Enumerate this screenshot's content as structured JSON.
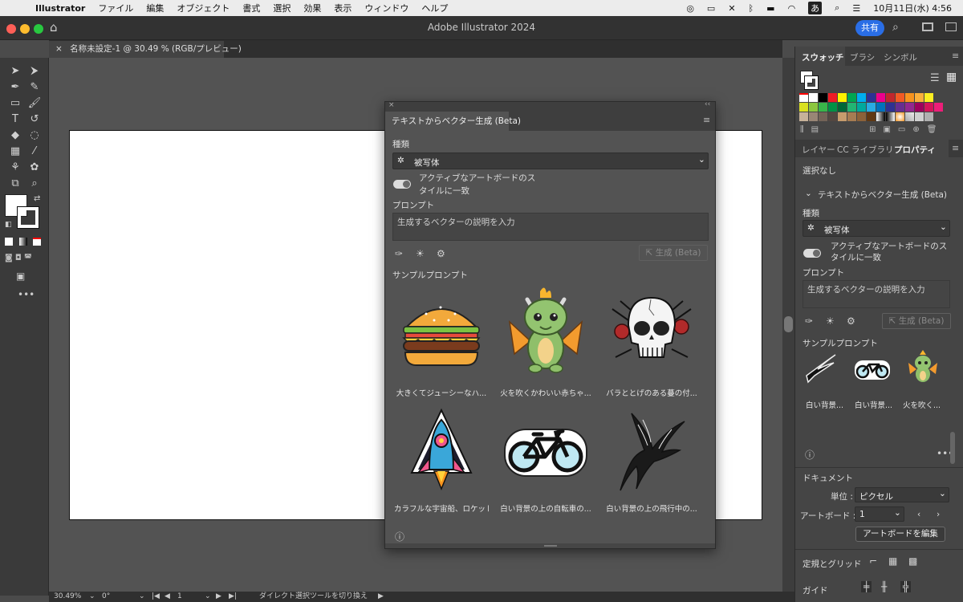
{
  "menubar": {
    "app": "Illustrator",
    "items": [
      "ファイル",
      "編集",
      "オブジェクト",
      "書式",
      "選択",
      "効果",
      "表示",
      "ウィンドウ",
      "ヘルプ"
    ],
    "ime": "あ",
    "clock": "10月11日(水)  4:56"
  },
  "window": {
    "title": "Adobe Illustrator 2024",
    "share_label": "共有",
    "doc_tab": "名称未設定-1 @ 30.49 % (RGB/プレビュー)"
  },
  "right_panel": {
    "tabs_top": [
      "スウォッチ",
      "ブラシ",
      "シンボル"
    ],
    "tabs_mid": [
      "レイヤー",
      "CC ライブラリ",
      "プロパティ"
    ],
    "no_selection": "選択なし",
    "section_title": "テキストからベクター生成 (Beta)",
    "kind_label": "種類",
    "kind_value": "被写体",
    "match_style": "アクティブなアートボードのスタイルに一致",
    "prompt_label": "プロンプト",
    "prompt_placeholder": "生成するベクターの説明を入力",
    "generate_label": "生成 (Beta)",
    "samples_label": "サンプルプロンプト",
    "sample_captions": [
      "白い背景...",
      "白い背景...",
      "火を吹く..."
    ],
    "document_label": "ドキュメント",
    "unit_label": "単位 :",
    "unit_value": "ピクセル",
    "artboard_label": "アートボード :",
    "artboard_value": "1",
    "edit_artboard": "アートボードを編集",
    "rulers_label": "定規とグリッド",
    "guides_label": "ガイド"
  },
  "dialog": {
    "tab": "テキストからベクター生成 (Beta)",
    "kind_label": "種類",
    "kind_value": "被写体",
    "match_style_line1": "アクティブなアートボードのス",
    "match_style_line2": "タイルに一致",
    "prompt_label": "プロンプト",
    "prompt_placeholder": "生成するベクターの説明を入力",
    "generate_label": "生成 (Beta)",
    "samples_label": "サンプルプロンプト",
    "samples": [
      {
        "caption": "大きくてジューシーなハ...",
        "icon": "hamburger-icon"
      },
      {
        "caption": "火を吹くかわいい赤ちゃ...",
        "icon": "dragon-icon"
      },
      {
        "caption": "バラととげのある蔓の付...",
        "icon": "skull-icon"
      },
      {
        "caption": "カラフルな宇宙船、ロケット",
        "icon": "rocket-icon"
      },
      {
        "caption": "白い背景の上の自転車の...",
        "icon": "bicycle-icon"
      },
      {
        "caption": "白い背景の上の飛行中の...",
        "icon": "bird-icon"
      }
    ]
  },
  "status": {
    "zoom": "30.49%",
    "rotation": "0°",
    "artboard_num": "1",
    "tool_hint": "ダイレクト選択ツールを切り換え"
  }
}
